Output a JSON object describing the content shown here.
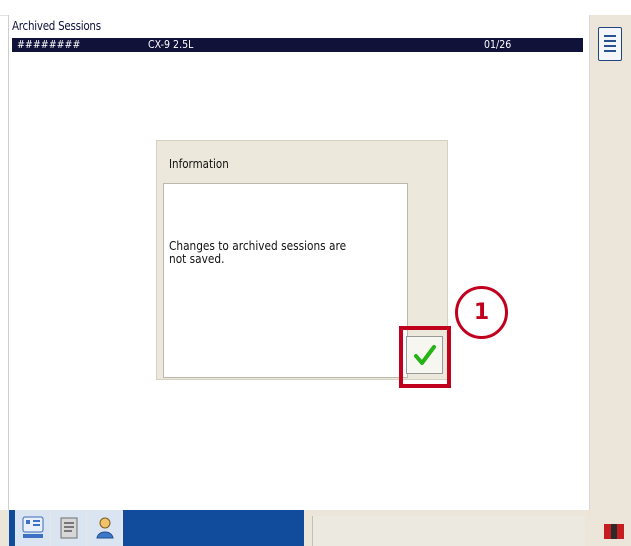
{
  "header": {
    "title": "Archived Sessions",
    "record_code": "########",
    "vehicle_label": "CX-9 2.5L",
    "date": "01/26"
  },
  "dialog": {
    "title": "Information",
    "message": "Changes to archived sessions are\nnot saved."
  },
  "callout": {
    "step_number": "1"
  },
  "icons": {
    "menu": "list-menu-icon",
    "confirm": "checkmark-icon",
    "tool1": "vehicle-diagnostics-icon",
    "tool2": "document-tool-icon",
    "tool3": "user-tool-icon",
    "bottom_right": "flag-icon"
  },
  "colors": {
    "header_bar": "#10123a",
    "dialog_bg": "#ece8db",
    "accent_red": "#c1001d",
    "taskbar_blue": "#104b9c",
    "check_green": "#26b315"
  }
}
